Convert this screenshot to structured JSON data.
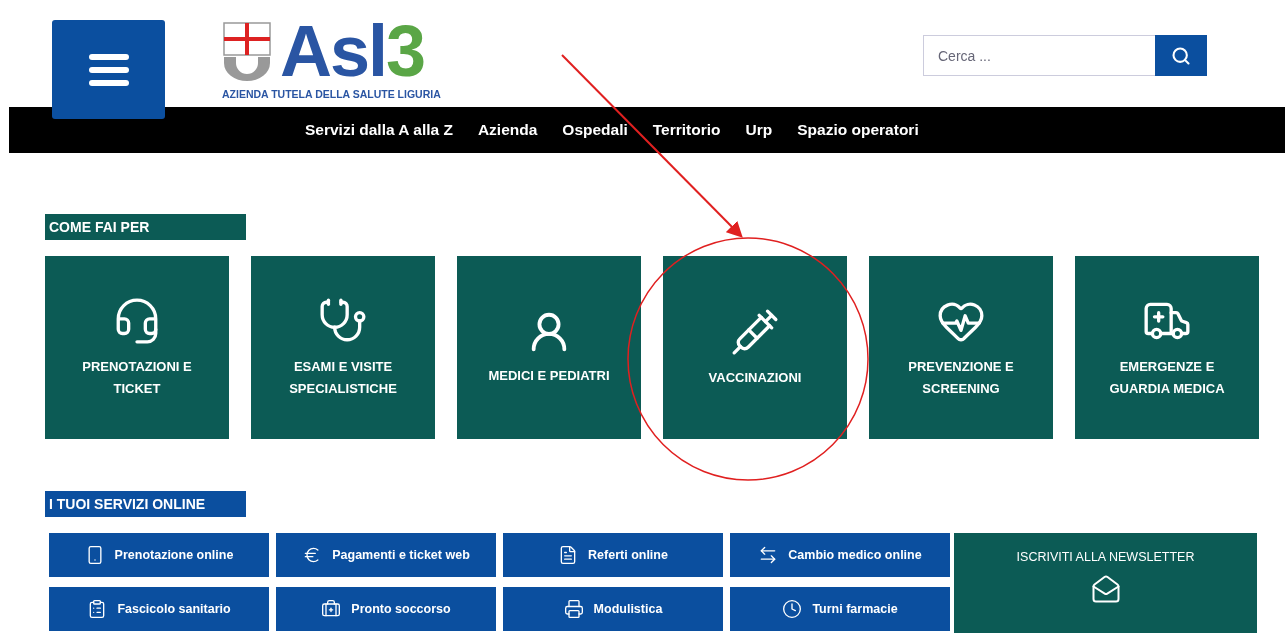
{
  "header": {
    "logo": {
      "wordmark": "Asl",
      "wordmark_suffix": "3",
      "tagline": "AZIENDA TUTELA DELLA SALUTE LIGURIA"
    },
    "search": {
      "placeholder": "Cerca ..."
    }
  },
  "nav": [
    "Servizi dalla A alla Z",
    "Azienda",
    "Ospedali",
    "Territorio",
    "Urp",
    "Spazio operatori"
  ],
  "come_fai_per": {
    "title": "COME FAI PER",
    "tiles": [
      {
        "kind": "headset",
        "label": "PRENOTAZIONI E TICKET"
      },
      {
        "kind": "stethoscope",
        "label": "ESAMI E VISITE SPECIALISTICHE"
      },
      {
        "kind": "doctor",
        "label": "MEDICI E PEDIATRI"
      },
      {
        "kind": "syringe",
        "label": "VACCINAZIONI"
      },
      {
        "kind": "heart",
        "label": "PREVENZIONE E SCREENING"
      },
      {
        "kind": "ambulance",
        "label": "EMERGENZE E GUARDIA MEDICA"
      }
    ]
  },
  "servizi_online": {
    "title": "I TUOI SERVIZI ONLINE",
    "buttons": [
      {
        "kind": "phone",
        "label": "Prenotazione online"
      },
      {
        "kind": "euro",
        "label": "Pagamenti e ticket web"
      },
      {
        "kind": "document",
        "label": "Referti online"
      },
      {
        "kind": "swap",
        "label": "Cambio medico online"
      },
      {
        "kind": "clipboard",
        "label": "Fascicolo sanitario"
      },
      {
        "kind": "firstaid",
        "label": "Pronto soccorso"
      },
      {
        "kind": "printer",
        "label": "Modulistica"
      },
      {
        "kind": "clock",
        "label": "Turni farmacie"
      }
    ],
    "newsletter": {
      "label": "ISCRIVITI ALLA NEWSLETTER"
    }
  }
}
